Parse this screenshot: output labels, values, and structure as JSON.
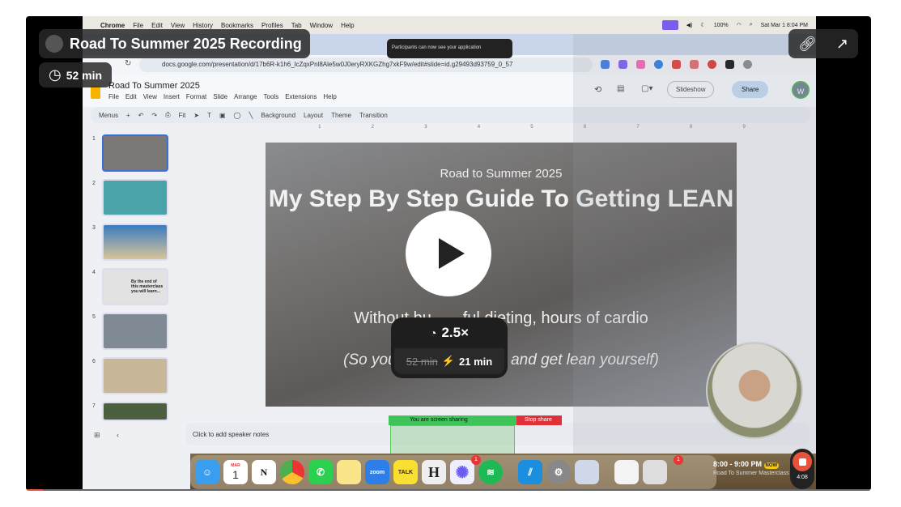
{
  "player": {
    "title": "Road To Summer 2025 Recording",
    "duration": "52 min",
    "speed": "2.5×",
    "original_time": "52 min",
    "fast_time": "21 min",
    "progress_percent": 2,
    "accent": "#e8523a"
  },
  "mac": {
    "menu": [
      "Chrome",
      "File",
      "Edit",
      "View",
      "History",
      "Bookmarks",
      "Profiles",
      "Tab",
      "Window",
      "Help"
    ],
    "battery": "100%",
    "clock": "Sat Mar 1  8:04 PM"
  },
  "toast": "Participants can now see your application",
  "browser": {
    "url": "docs.google.com/presentation/d/17b6R-k1h6_lcZqxPnl8Ale5w0J0eryRXKGZhg7xkF9w/edit#slide=id.g29493d93759_0_57"
  },
  "slides": {
    "doc_title": "Road To Summer 2025",
    "menu": [
      "File",
      "Edit",
      "View",
      "Insert",
      "Format",
      "Slide",
      "Arrange",
      "Tools",
      "Extensions",
      "Help"
    ],
    "slideshow": "Slideshow",
    "share": "Share",
    "avatar": "W",
    "toolbar": {
      "menus": "Menus",
      "zoom": "Fit",
      "background": "Background",
      "layout": "Layout",
      "theme": "Theme",
      "transition": "Transition"
    },
    "ruler": [
      "1",
      "2",
      "3",
      "4",
      "5",
      "6",
      "7",
      "8",
      "9"
    ],
    "thumbs": [
      "1",
      "2",
      "3",
      "4",
      "5",
      "6",
      "7"
    ],
    "thumb4_text": "By the end of this masterclass you will learn...",
    "current": {
      "subtitle": "Road to Summer 2025",
      "title": "My Step By Step Guide To Getting LEAN",
      "line1": "Without bu... ...ful dieting, hours of cardio",
      "line2": "(So you can ... ...ormula and get lean yourself)"
    },
    "notes": "Click to add speaker notes"
  },
  "zoom_share": {
    "status": "You are screen sharing",
    "stop": "Stop share"
  },
  "dock": {
    "apps": [
      "Finder",
      "Calendar",
      "Notion",
      "Chrome",
      "WhatsApp",
      "Notes",
      "zoom",
      "TALK",
      "H",
      "Perplexity",
      "Spotify",
      "Linear",
      "Settings",
      "Preview"
    ],
    "calendar_month": "MAR",
    "calendar_day": "1",
    "zoom_badge": "1",
    "settings_badge": "1",
    "event_time": "8:00 - 9:00 PM",
    "event_now": "NOW",
    "event_name": "Road To Summer Masterclass"
  },
  "recorder": {
    "elapsed": "4:08"
  }
}
